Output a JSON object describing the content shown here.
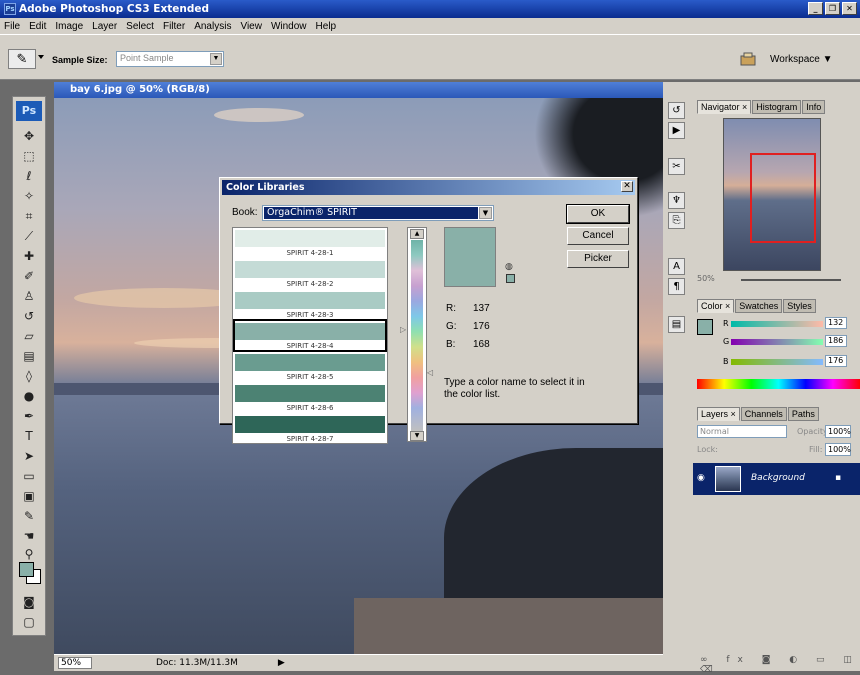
{
  "app": {
    "title": "Adobe Photoshop CS3 Extended",
    "menu": [
      "File",
      "Edit",
      "Image",
      "Layer",
      "Select",
      "Filter",
      "Analysis",
      "View",
      "Window",
      "Help"
    ]
  },
  "options_bar": {
    "sample_size_label": "Sample Size:",
    "sample_size_value": "Point Sample",
    "workspace_label": "Workspace ▼"
  },
  "toolbox": {
    "logo": "Ps",
    "tools": [
      "move-tool",
      "marquee-tool",
      "lasso-tool",
      "quick-select-tool",
      "crop-tool",
      "slice-tool",
      "healing-tool",
      "brush-tool",
      "stamp-tool",
      "history-brush-tool",
      "eraser-tool",
      "gradient-tool",
      "blur-tool",
      "dodge-tool",
      "pen-tool",
      "type-tool",
      "path-select-tool",
      "shape-tool",
      "notes-tool",
      "eyedropper-tool",
      "hand-tool",
      "zoom-tool"
    ],
    "foreground_color": "#89b0a8",
    "background_color": "#ffffff"
  },
  "document": {
    "title": "bay 6.jpg @ 50% (RGB/8)",
    "zoom": "50%",
    "doc_size": "Doc: 11.3M/11.3M"
  },
  "dialog": {
    "title": "Color Libraries",
    "book_label": "Book:",
    "book_value": "OrgaChim® SPIRIT",
    "swatches": [
      {
        "name": "SPIRIT 4-28-1",
        "color": "#e1ede8"
      },
      {
        "name": "SPIRIT 4-28-2",
        "color": "#c4dbd6"
      },
      {
        "name": "SPIRIT 4-28-3",
        "color": "#a9cbc4"
      },
      {
        "name": "SPIRIT 4-28-4",
        "color": "#89b0a8"
      },
      {
        "name": "SPIRIT 4-28-5",
        "color": "#6a9c90"
      },
      {
        "name": "SPIRIT 4-28-6",
        "color": "#4c8273"
      },
      {
        "name": "SPIRIT 4-28-7",
        "color": "#2e6658"
      }
    ],
    "selected_swatch": "SPIRIT 4-28-4",
    "r_label": "R:",
    "g_label": "G:",
    "b_label": "B:",
    "r": "137",
    "g": "176",
    "b": "168",
    "hint": "Type a color name to select it in the color list.",
    "ok": "OK",
    "cancel": "Cancel",
    "picker": "Picker"
  },
  "navigator": {
    "tabs": [
      "Navigator ×",
      "Histogram",
      "Info"
    ],
    "zoom": "50%"
  },
  "color_panel": {
    "tabs": [
      "Color ×",
      "Swatches",
      "Styles"
    ],
    "r_label": "R",
    "g_label": "G",
    "b_label": "B",
    "r": "132",
    "g": "186",
    "b": "176"
  },
  "layers_panel": {
    "tabs": [
      "Layers ×",
      "Channels",
      "Paths"
    ],
    "blend_mode": "Normal",
    "opacity_label": "Opacity:",
    "opacity": "100%",
    "lock_label": "Lock:",
    "fill_label": "Fill:",
    "fill": "100%",
    "layer_name": "Background"
  }
}
